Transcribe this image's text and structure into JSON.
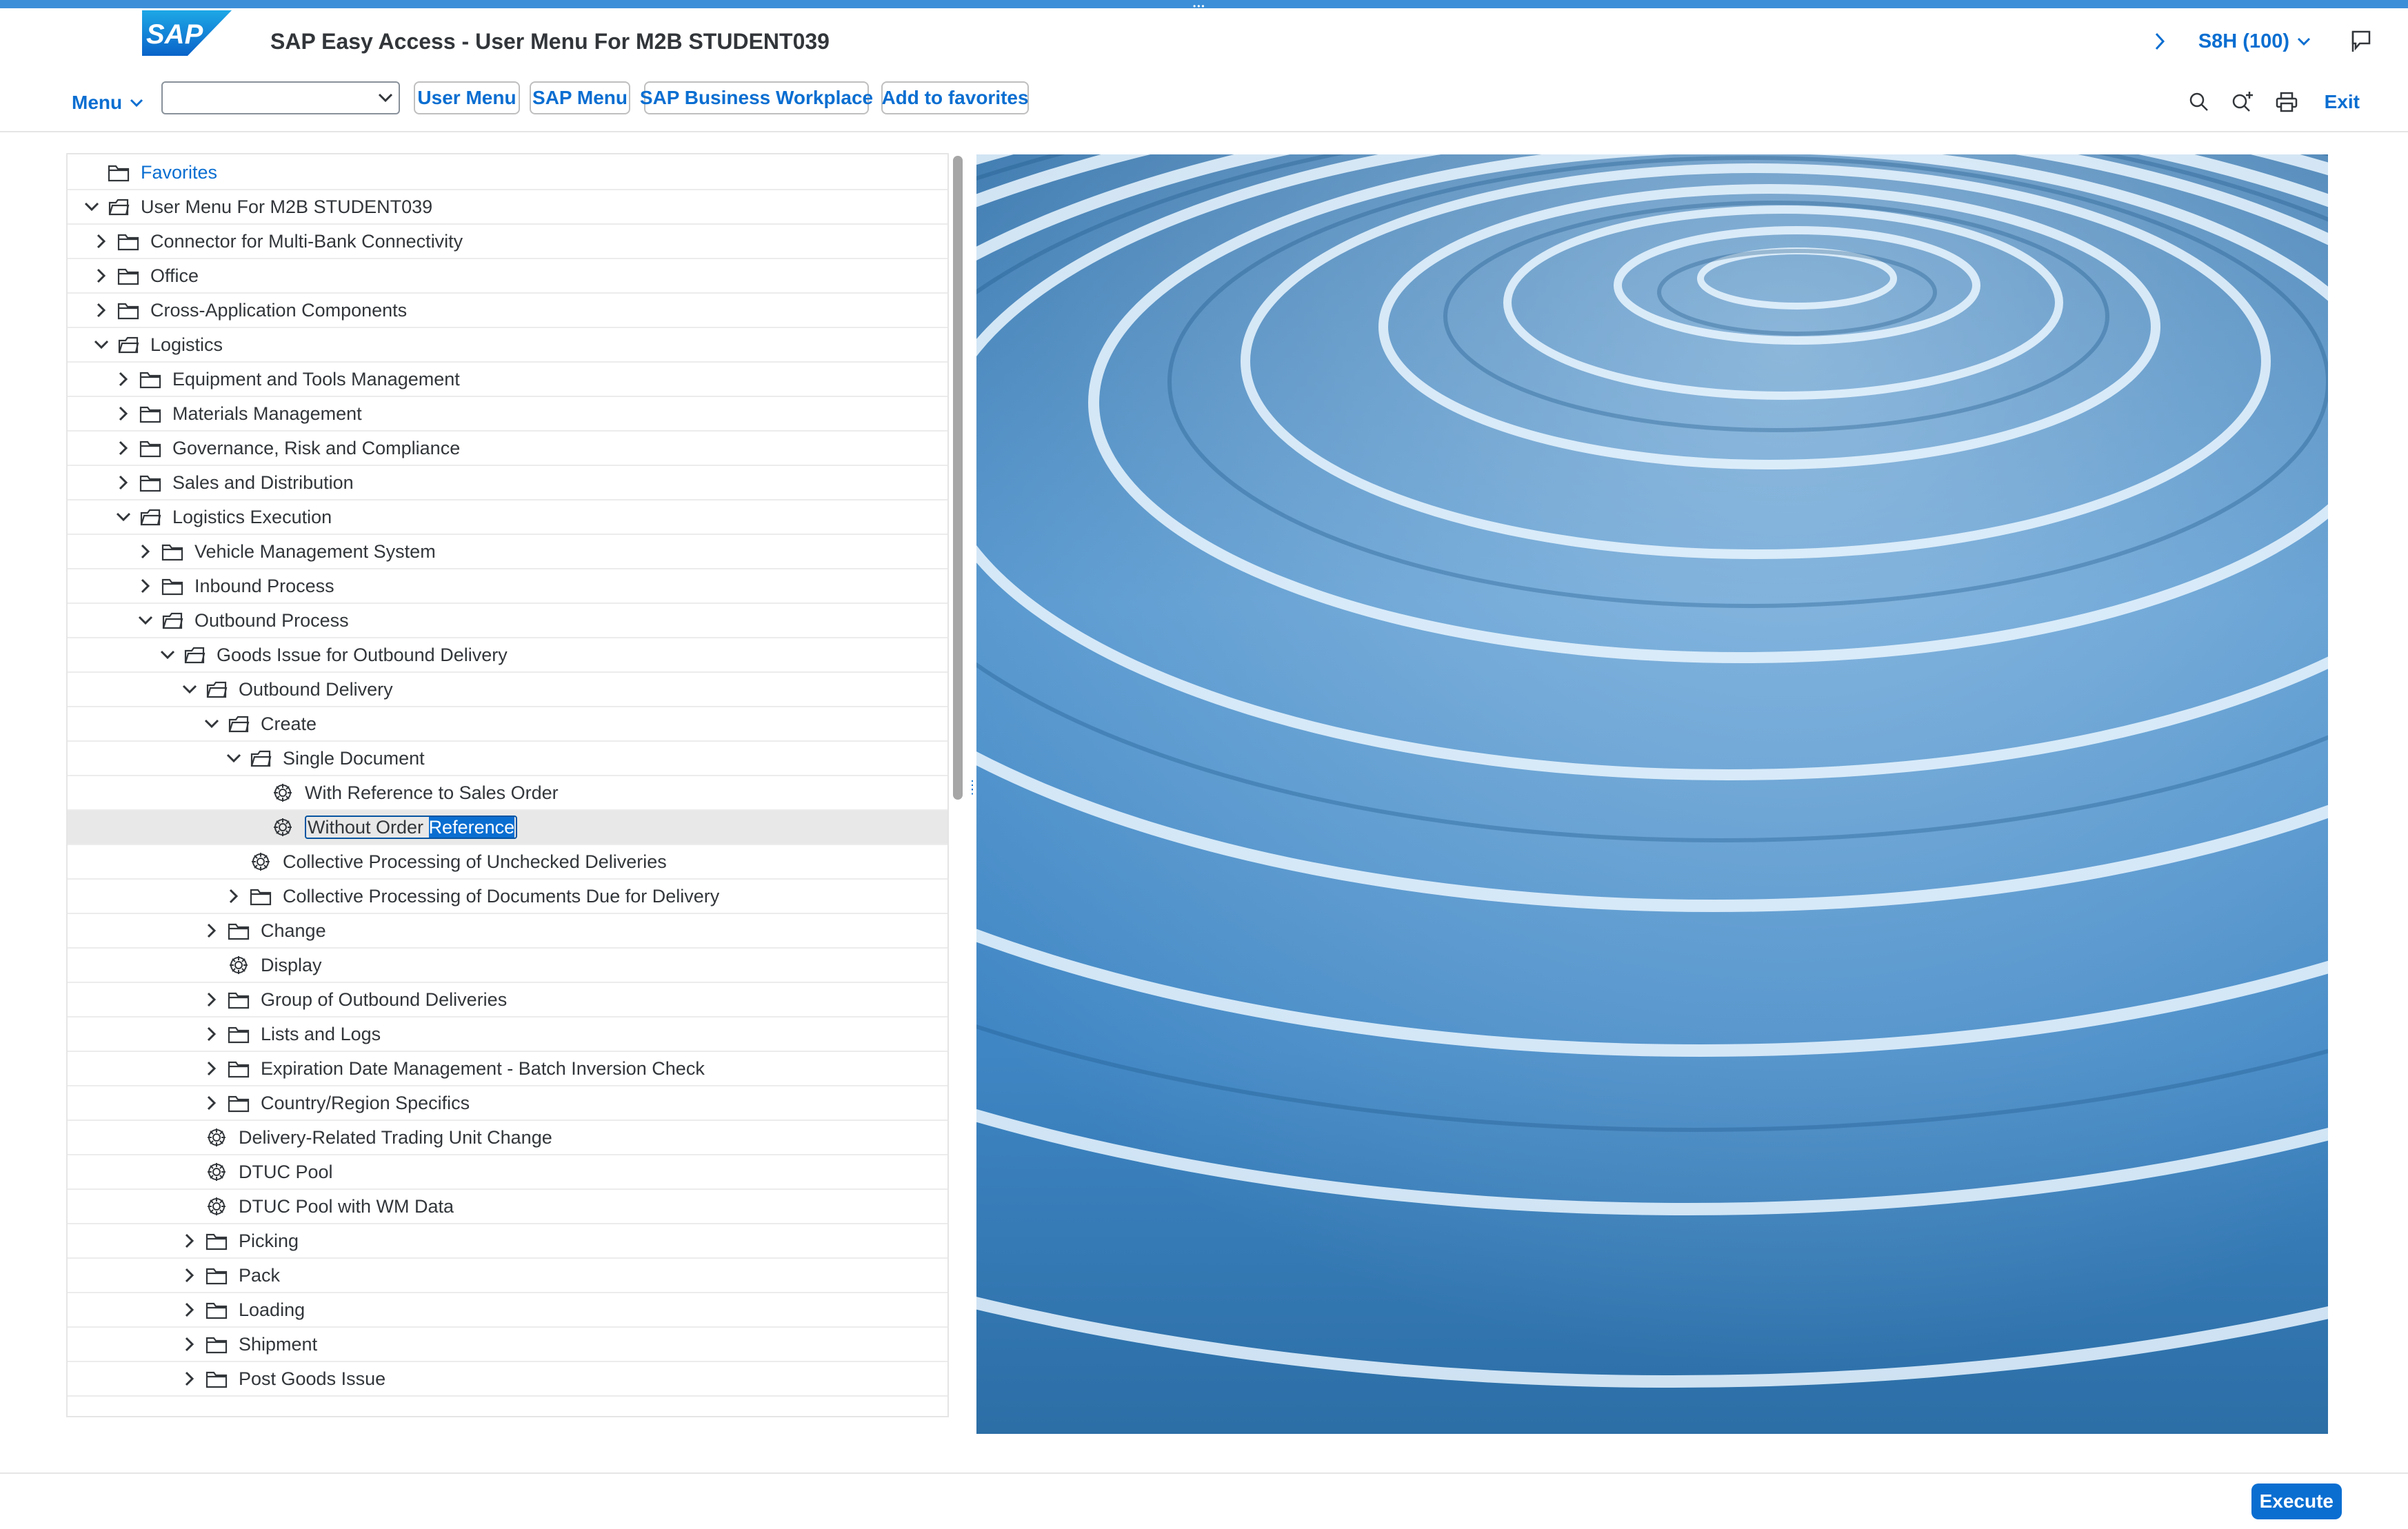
{
  "shell": {
    "logo_text": "SAP",
    "title": "SAP Easy Access  -  User Menu For M2B STUDENT039",
    "system": "S8H (100)"
  },
  "toolbar": {
    "menu_label": "Menu",
    "combo_value": "",
    "buttons": [
      "User Menu",
      "SAP Menu",
      "SAP Business Workplace",
      "Add to favorites"
    ],
    "exit_label": "Exit"
  },
  "tree": [
    {
      "label": "Favorites",
      "level": 0,
      "icon": "folder-icon",
      "expander": "none"
    },
    {
      "label": "User Menu For M2B STUDENT039",
      "level": 0,
      "icon": "open-folder-icon",
      "expander": "expanded"
    },
    {
      "label": "Connector for Multi-Bank Connectivity",
      "level": 1,
      "icon": "folder-icon",
      "expander": "collapsed"
    },
    {
      "label": "Office",
      "level": 1,
      "icon": "folder-icon",
      "expander": "collapsed"
    },
    {
      "label": "Cross-Application Components",
      "level": 1,
      "icon": "folder-icon",
      "expander": "collapsed"
    },
    {
      "label": "Logistics",
      "level": 1,
      "icon": "open-folder-icon",
      "expander": "expanded"
    },
    {
      "label": "Equipment and Tools Management",
      "level": 2,
      "icon": "folder-icon",
      "expander": "collapsed"
    },
    {
      "label": "Materials Management",
      "level": 2,
      "icon": "folder-icon",
      "expander": "collapsed"
    },
    {
      "label": "Governance, Risk and Compliance",
      "level": 2,
      "icon": "folder-icon",
      "expander": "collapsed"
    },
    {
      "label": "Sales and Distribution",
      "level": 2,
      "icon": "folder-icon",
      "expander": "collapsed"
    },
    {
      "label": "Logistics Execution",
      "level": 2,
      "icon": "open-folder-icon",
      "expander": "expanded"
    },
    {
      "label": "Vehicle Management System",
      "level": 3,
      "icon": "folder-icon",
      "expander": "collapsed"
    },
    {
      "label": "Inbound Process",
      "level": 3,
      "icon": "folder-icon",
      "expander": "collapsed"
    },
    {
      "label": "Outbound Process",
      "level": 3,
      "icon": "open-folder-icon",
      "expander": "expanded"
    },
    {
      "label": "Goods Issue for Outbound Delivery",
      "level": 4,
      "icon": "open-folder-icon",
      "expander": "expanded"
    },
    {
      "label": "Outbound Delivery",
      "level": 5,
      "icon": "open-folder-icon",
      "expander": "expanded"
    },
    {
      "label": "Create",
      "level": 6,
      "icon": "open-folder-icon",
      "expander": "expanded"
    },
    {
      "label": "Single Document",
      "level": 7,
      "icon": "open-folder-icon",
      "expander": "expanded"
    },
    {
      "label": "With Reference to Sales Order",
      "level": 8,
      "icon": "transaction-icon",
      "expander": "none"
    },
    {
      "label": "Without Order Reference",
      "level": 8,
      "icon": "transaction-icon",
      "expander": "none",
      "selected": true,
      "sel_plain": "Without Order ",
      "sel_hl": "Reference"
    },
    {
      "label": "Collective Processing of Unchecked Deliveries",
      "level": 7,
      "icon": "transaction-icon",
      "expander": "none"
    },
    {
      "label": "Collective Processing of Documents Due for Delivery",
      "level": 7,
      "icon": "folder-icon",
      "expander": "collapsed"
    },
    {
      "label": "Change",
      "level": 6,
      "icon": "folder-icon",
      "expander": "collapsed"
    },
    {
      "label": "Display",
      "level": 6,
      "icon": "transaction-icon",
      "expander": "none"
    },
    {
      "label": "Group of Outbound Deliveries",
      "level": 6,
      "icon": "folder-icon",
      "expander": "collapsed"
    },
    {
      "label": "Lists and Logs",
      "level": 6,
      "icon": "folder-icon",
      "expander": "collapsed"
    },
    {
      "label": "Expiration Date Management - Batch Inversion Check",
      "level": 6,
      "icon": "folder-icon",
      "expander": "collapsed"
    },
    {
      "label": "Country/Region Specifics",
      "level": 6,
      "icon": "folder-icon",
      "expander": "collapsed"
    },
    {
      "label": "Delivery-Related Trading Unit Change",
      "level": 5,
      "icon": "transaction-icon",
      "expander": "none"
    },
    {
      "label": "DTUC Pool",
      "level": 5,
      "icon": "transaction-icon",
      "expander": "none"
    },
    {
      "label": "DTUC Pool with WM Data",
      "level": 5,
      "icon": "transaction-icon",
      "expander": "none"
    },
    {
      "label": "Picking",
      "level": 5,
      "icon": "folder-icon",
      "expander": "collapsed"
    },
    {
      "label": "Pack",
      "level": 5,
      "icon": "folder-icon",
      "expander": "collapsed"
    },
    {
      "label": "Loading",
      "level": 5,
      "icon": "folder-icon",
      "expander": "collapsed"
    },
    {
      "label": "Shipment",
      "level": 5,
      "icon": "folder-icon",
      "expander": "collapsed"
    },
    {
      "label": "Post Goods Issue",
      "level": 5,
      "icon": "folder-icon",
      "expander": "collapsed"
    }
  ],
  "footer": {
    "execute_label": "Execute"
  },
  "colors": {
    "accent": "#0a6ed1",
    "topbar": "#3c8ed8",
    "selected_row": "#e8e8e8"
  }
}
